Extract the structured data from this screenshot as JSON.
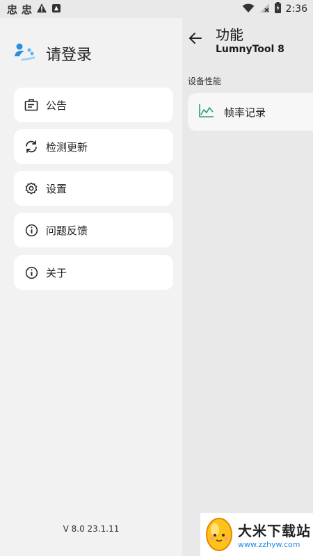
{
  "status_bar": {
    "left_glyphs": [
      "忠",
      "忠"
    ],
    "time": "2:36"
  },
  "drawer": {
    "login_title": "请登录",
    "items": [
      {
        "label": "公告",
        "icon": "announcement-icon"
      },
      {
        "label": "检测更新",
        "icon": "refresh-icon"
      },
      {
        "label": "设置",
        "icon": "gear-icon"
      },
      {
        "label": "问题反馈",
        "icon": "info-icon"
      },
      {
        "label": "关于",
        "icon": "info-icon"
      }
    ],
    "version": "V 8.0 23.1.11"
  },
  "content": {
    "title": "功能",
    "subtitle": "LumnyTool 8",
    "section_label": "设备性能",
    "feature": {
      "label": "帧率记录",
      "icon": "chart-icon"
    }
  },
  "watermark": {
    "title": "大米下载站",
    "url": "www.zzhyw.com"
  },
  "colors": {
    "background": "#e9e9ea",
    "card": "#ffffff",
    "accent_green": "#2e9e6b",
    "accent_blue": "#2a8ee0"
  }
}
